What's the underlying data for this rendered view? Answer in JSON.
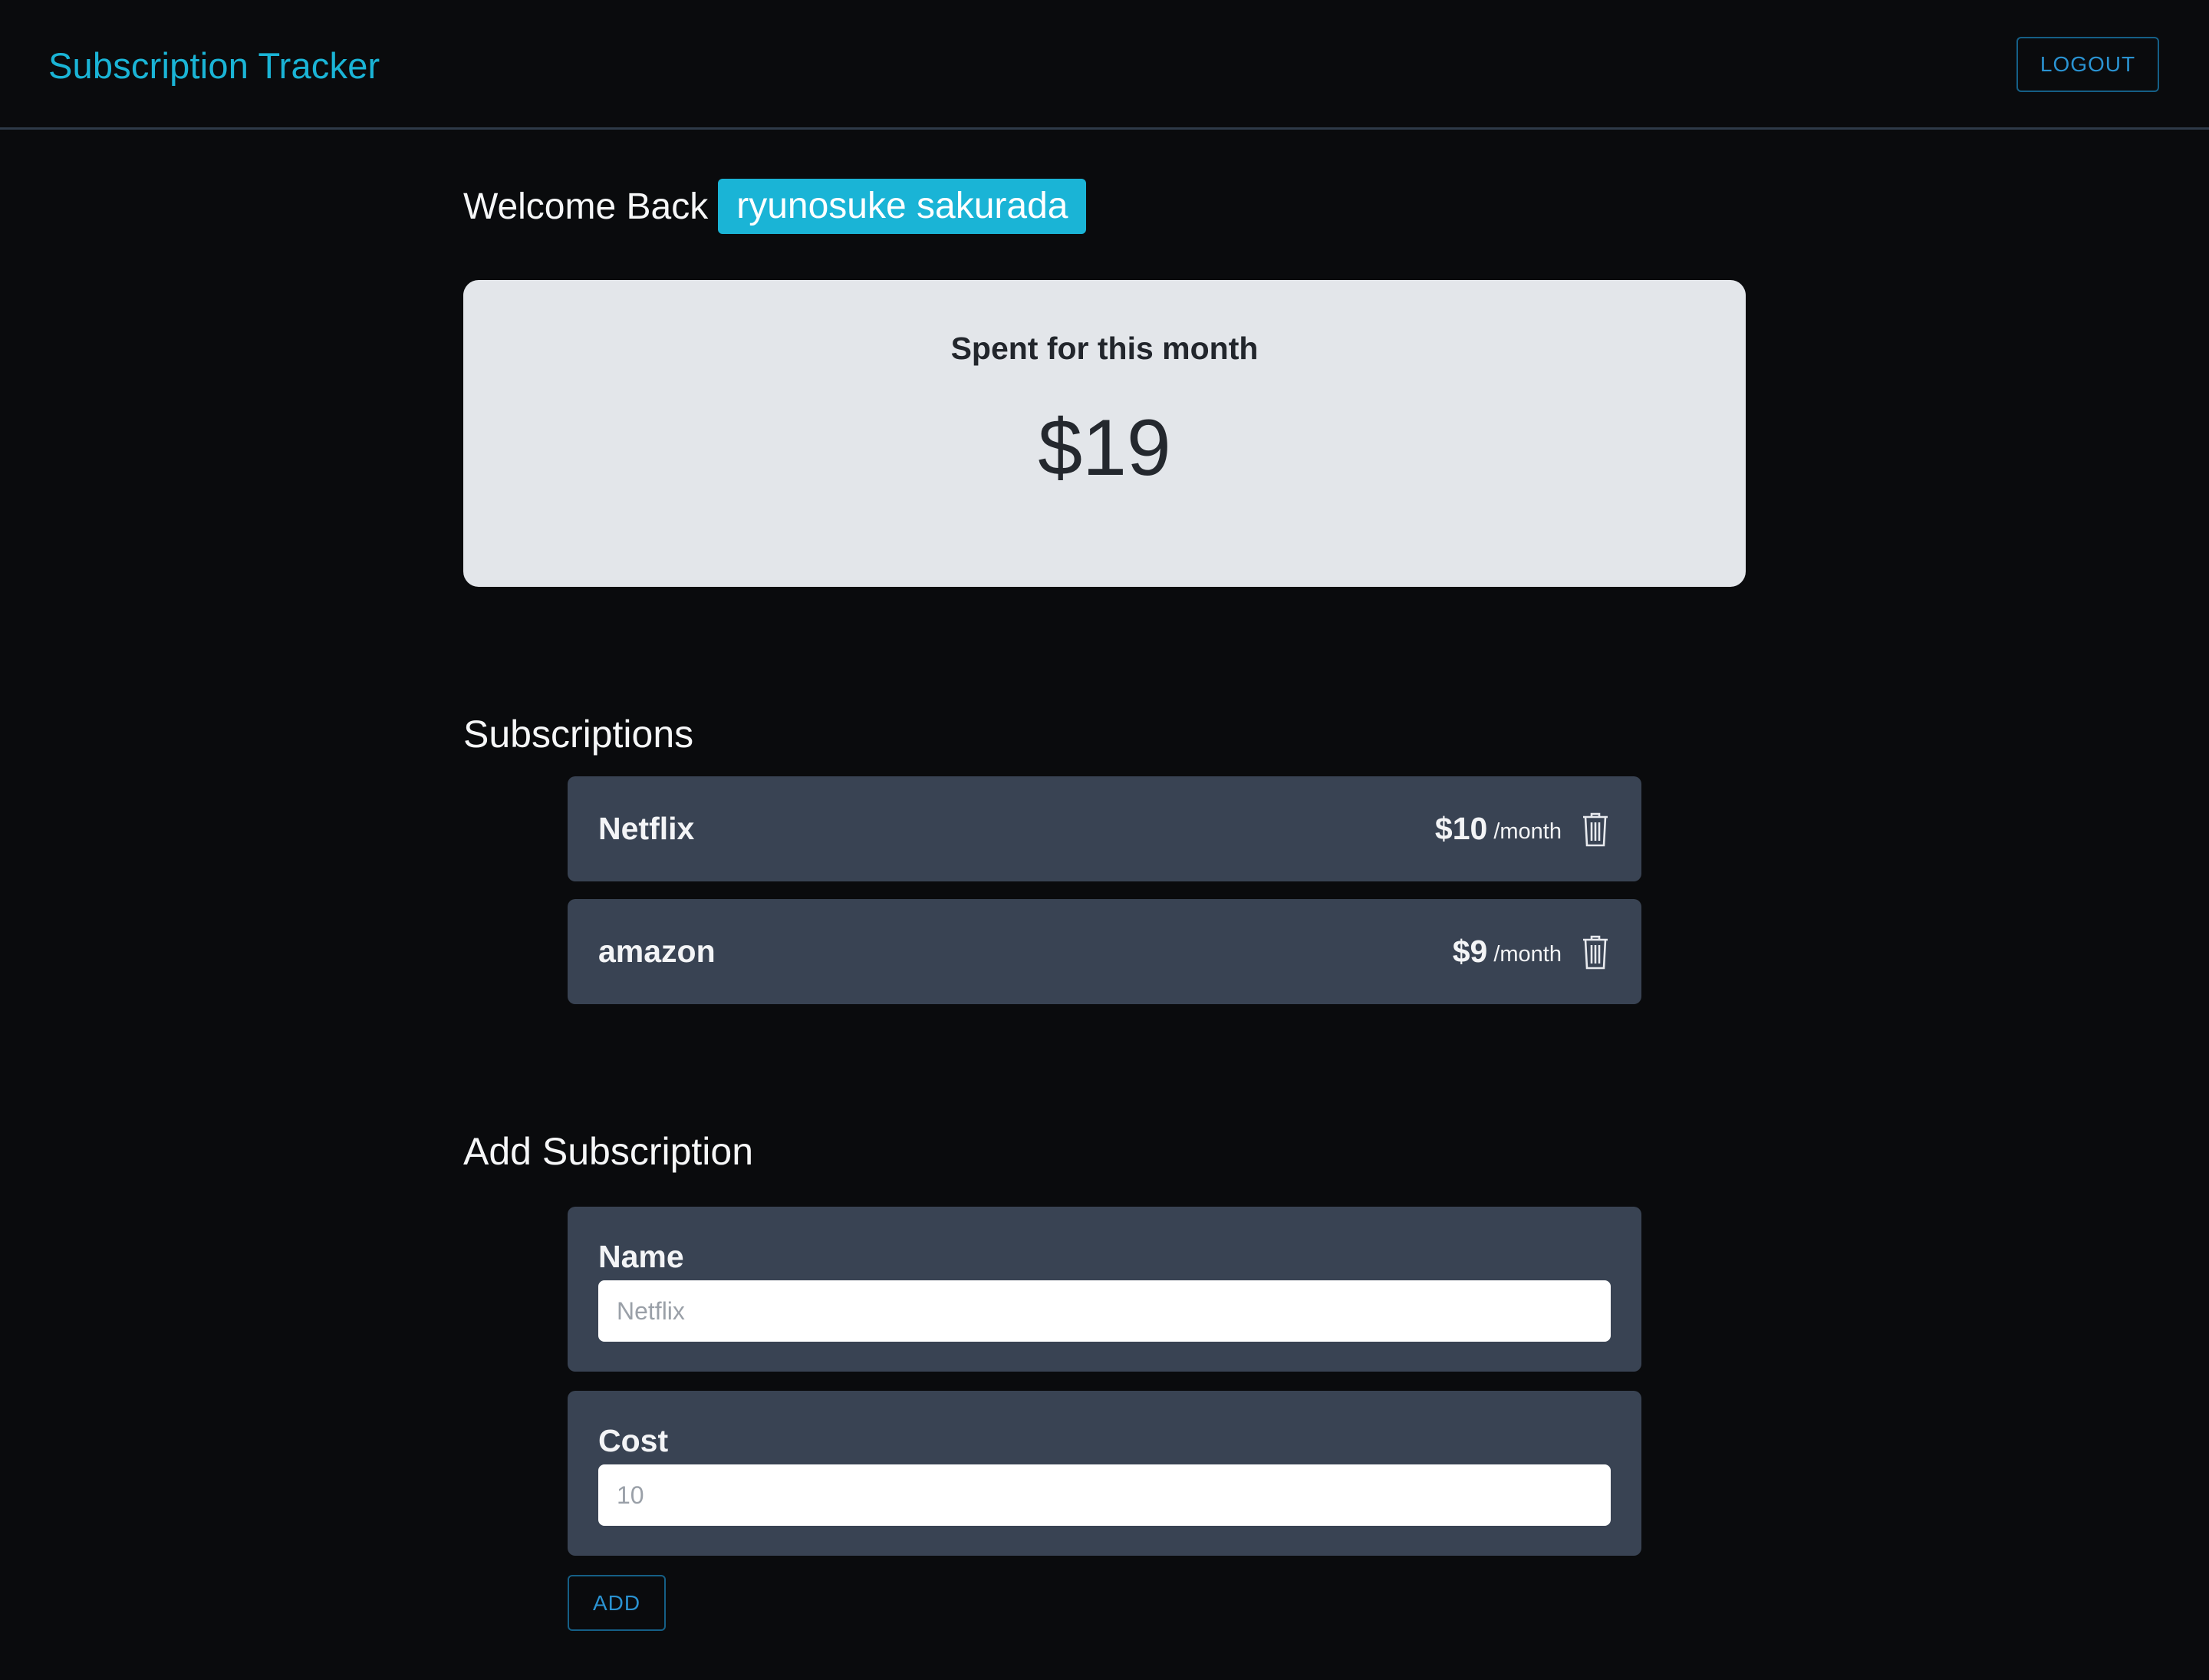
{
  "header": {
    "title": "Subscription Tracker",
    "logout_label": "LOGOUT"
  },
  "welcome": {
    "greeting": "Welcome Back",
    "user_name": "ryunosuke sakurada"
  },
  "spent": {
    "title": "Spent for this month",
    "amount": "$19"
  },
  "subscriptions": {
    "title": "Subscriptions",
    "items": [
      {
        "name": "Netflix",
        "cost": "$10",
        "period": "/month",
        "delete_icon": "trash-icon"
      },
      {
        "name": "amazon",
        "cost": "$9",
        "period": "/month",
        "delete_icon": "trash-icon"
      }
    ]
  },
  "add_form": {
    "title": "Add Subscription",
    "name_label": "Name",
    "name_value": "",
    "name_placeholder": "Netflix",
    "cost_label": "Cost",
    "cost_value": "",
    "cost_placeholder": "10",
    "add_label": "ADD"
  },
  "colors": {
    "background": "#0a0b0d",
    "accent": "#1ab4d6",
    "button_text": "#2a93d2",
    "card_light": "#e3e6ea",
    "card_dark": "#394353"
  }
}
